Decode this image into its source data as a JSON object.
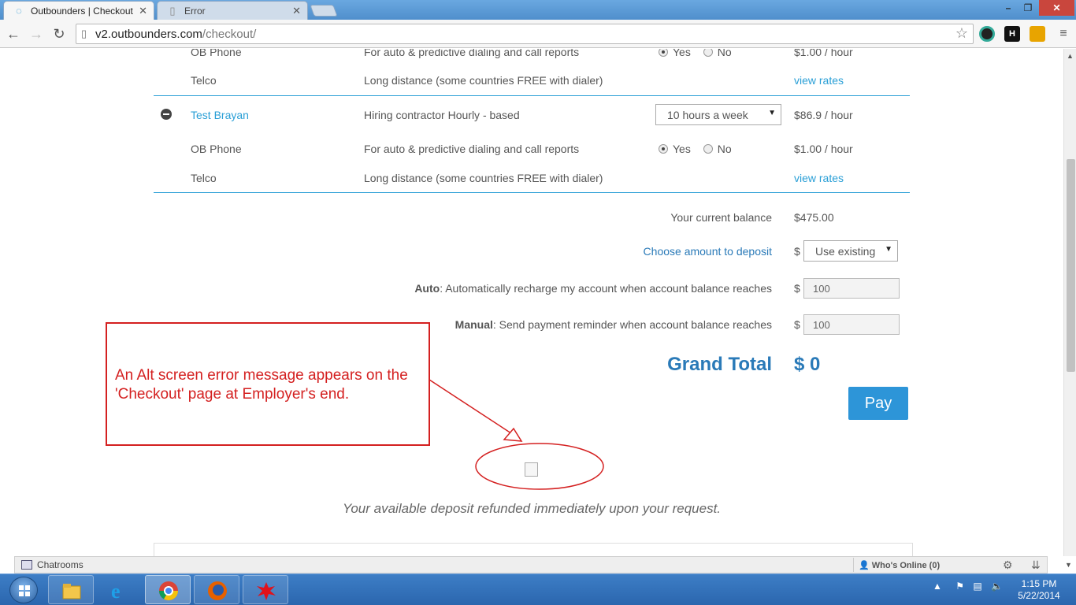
{
  "browser": {
    "tabs": [
      {
        "label": "Outbounders | Checkout",
        "active": true
      },
      {
        "label": "Error",
        "active": false
      }
    ],
    "url_host": "v2.outbounders.com",
    "url_path": "/checkout/",
    "window_buttons": {
      "minimize": "–",
      "maximize": "❐",
      "close": "✕"
    },
    "extensions": [
      {
        "name": "color-wheel-icon",
        "color": "#222222",
        "label": ""
      },
      {
        "name": "h-extension-icon",
        "color": "#111111",
        "label": "H"
      },
      {
        "name": "folder-extension-icon",
        "color": "#e8a400",
        "label": ""
      }
    ]
  },
  "checkout": {
    "first_group": {
      "ob_phone": {
        "name": "OB Phone",
        "description": "For auto & predictive dialing and call reports",
        "yes_label": "Yes",
        "no_label": "No",
        "selected": "Yes",
        "price": "$1.00 / hour"
      },
      "telco": {
        "name": "Telco",
        "description": "Long distance (some countries FREE with dialer)",
        "link": "view rates"
      }
    },
    "contractor": {
      "name": "Test Brayan",
      "description": "Hiring contractor Hourly - based",
      "hours_selected": "10 hours a week",
      "price": "$86.9 / hour",
      "ob_phone": {
        "name": "OB Phone",
        "description": "For auto & predictive dialing and call reports",
        "yes_label": "Yes",
        "no_label": "No",
        "selected": "Yes",
        "price": "$1.00 / hour"
      },
      "telco": {
        "name": "Telco",
        "description": "Long distance (some countries FREE with dialer)",
        "link": "view rates"
      }
    },
    "balance_label": "Your current balance",
    "balance_value": "$475.00",
    "deposit_label": "Choose amount to deposit",
    "currency_symbol": "$",
    "deposit_selected": "Use existing",
    "auto_bold": "Auto",
    "auto_text": ": Automatically recharge my account when account balance reaches",
    "auto_value": "100",
    "manual_bold": "Manual",
    "manual_text": ": Send payment reminder when account balance reaches",
    "manual_value": "100",
    "grand_total_label": "Grand Total",
    "grand_total_value": "$ 0",
    "pay_label": "Pay",
    "refund_note": "Your available deposit refunded immediately upon your request."
  },
  "annotation": {
    "text": "An Alt screen error message appears on the 'Checkout' page at Employer's end.",
    "color": "#d42020"
  },
  "chatbar": {
    "chatrooms_label": "Chatrooms",
    "whos_online_label": "Who's Online (0)"
  },
  "taskbar": {
    "apps": [
      "file-explorer-icon",
      "internet-explorer-icon",
      "chrome-icon",
      "firefox-icon",
      "red-splat-app-icon"
    ],
    "clock_time": "1:15 PM",
    "clock_date": "5/22/2014"
  },
  "colors": {
    "accent": "#2a9fd6",
    "grand_total": "#2a7ab8",
    "pay_button": "#2d95d8"
  }
}
